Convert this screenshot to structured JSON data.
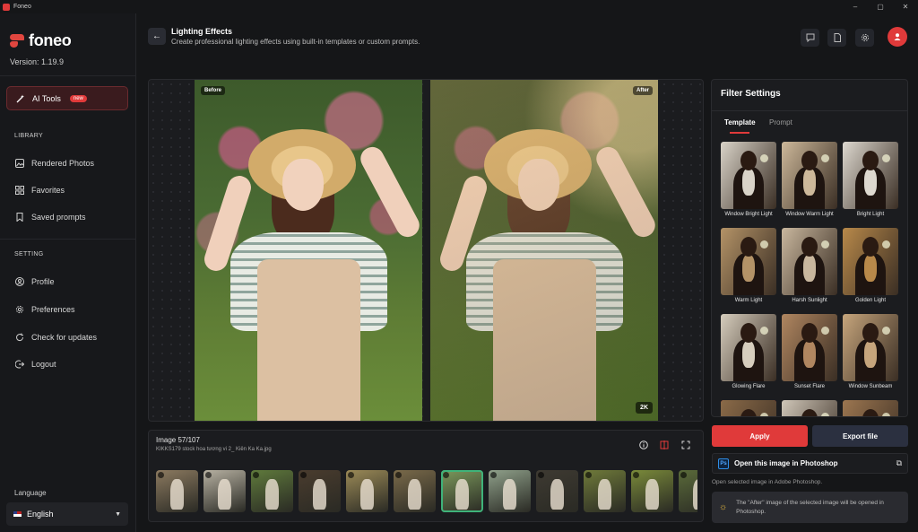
{
  "window": {
    "title": "Foneo",
    "controls": [
      "–",
      "▢",
      "✕"
    ]
  },
  "app": {
    "brand": "foneo",
    "version": "Version: 1.19.9"
  },
  "sidebar": {
    "ai_tools": {
      "label": "AI Tools",
      "badge": "new"
    },
    "library_heading": "LIBRARY",
    "library": [
      {
        "label": "Rendered Photos",
        "icon": "image-icon"
      },
      {
        "label": "Favorites",
        "icon": "grid-icon"
      },
      {
        "label": "Saved prompts",
        "icon": "bookmark-icon"
      }
    ],
    "setting_heading": "SETTING",
    "settings": [
      {
        "label": "Profile",
        "icon": "user-icon"
      },
      {
        "label": "Preferences",
        "icon": "gear-icon"
      },
      {
        "label": "Check for updates",
        "icon": "refresh-icon"
      },
      {
        "label": "Logout",
        "icon": "logout-icon"
      }
    ],
    "language_label": "Language",
    "language_value": "English"
  },
  "header": {
    "title": "Lighting Effects",
    "subtitle": "Create professional lighting effects using built-in templates or custom prompts.",
    "icons": [
      "chat-icon",
      "document-icon",
      "gear-icon",
      "user-avatar"
    ]
  },
  "compare": {
    "before_label": "Before",
    "after_label": "After",
    "resolution": "2K"
  },
  "info": {
    "count": "Image 57/107",
    "filename": "KIKKS179 stock hoa tương vi 2_ Kiên Ka Ka.jpg",
    "tools": [
      "info-icon",
      "compare-icon",
      "fullscreen-icon"
    ]
  },
  "filter": {
    "title": "Filter Settings",
    "tabs": [
      "Template",
      "Prompt"
    ],
    "active_tab": "Template",
    "templates": [
      {
        "label": "Window Bright Light",
        "tone": "#d9d3c8"
      },
      {
        "label": "Window Warm Light",
        "tone": "#cdb89a"
      },
      {
        "label": "Bright Light",
        "tone": "#ddd8cf"
      },
      {
        "label": "Warm Light",
        "tone": "#b49367"
      },
      {
        "label": "Harsh Sunlight",
        "tone": "#c9b79e"
      },
      {
        "label": "Golden Light",
        "tone": "#b8894a"
      },
      {
        "label": "Glowing Flare",
        "tone": "#d6cdbd"
      },
      {
        "label": "Sunset Flare",
        "tone": "#b08660"
      },
      {
        "label": "Window Sunbeam",
        "tone": "#c6a57c"
      },
      {
        "label": "",
        "tone": "#8a6a48"
      },
      {
        "label": "",
        "tone": "#cfc6b8"
      },
      {
        "label": "",
        "tone": "#9c7650"
      }
    ]
  },
  "actions": {
    "apply": "Apply",
    "export": "Export file",
    "photoshop": "Open this image in Photoshop",
    "photoshop_icon_text": "Ps",
    "photoshop_hint": "Open selected image in Adobe Photoshop.",
    "note": "The \"After\" image of the selected image will be opened in Photoshop."
  },
  "thumbnails": [
    {
      "tone": "#8c7a60"
    },
    {
      "tone": "#b7b1a2"
    },
    {
      "tone": "#5f7a3c"
    },
    {
      "tone": "#4a3c2e"
    },
    {
      "tone": "#9b8a57"
    },
    {
      "tone": "#7a6a4a"
    },
    {
      "tone": "#7c9a5c"
    },
    {
      "tone": "#8fa08a"
    },
    {
      "tone": "#3e3a32"
    },
    {
      "tone": "#6f7a3a"
    },
    {
      "tone": "#7a8a3a"
    },
    {
      "tone": "#5a6a3a"
    }
  ],
  "selected_thumbnail": 6
}
